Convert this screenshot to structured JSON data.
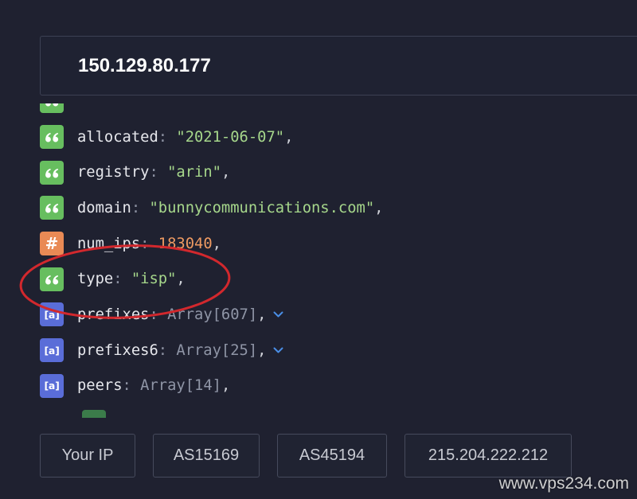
{
  "search": {
    "query": "150.129.80.177"
  },
  "syntax": {
    "colon": ":",
    "comma": ","
  },
  "icons": {
    "string": {
      "name": "quote-icon",
      "color": "#67be5f"
    },
    "number": {
      "name": "hash-icon",
      "glyph": "#",
      "color": "#e98a55"
    },
    "array": {
      "name": "array-icon",
      "glyph": "[a]",
      "color": "#5a6dd8"
    }
  },
  "rows": [
    {
      "icon": "quote-icon"
    },
    {
      "icon": "quote-icon",
      "key": "allocated",
      "value": "\"2021-06-07\""
    },
    {
      "icon": "quote-icon",
      "key": "registry",
      "value": "\"arin\""
    },
    {
      "icon": "quote-icon",
      "key": "domain",
      "value": "\"bunnycommunications.com\""
    },
    {
      "icon": "hash-icon",
      "key": "num_ips",
      "value": "183040"
    },
    {
      "icon": "quote-icon",
      "key": "type",
      "value": "\"isp\"",
      "highlighted": true
    },
    {
      "icon": "array-icon",
      "key": "prefixes",
      "value": "Array[607]",
      "expandable": true
    },
    {
      "icon": "array-icon",
      "key": "prefixes6",
      "value": "Array[25]",
      "expandable": true
    },
    {
      "icon": "array-icon",
      "key": "peers",
      "value": "Array[14]"
    },
    {
      "icon": "quote-icon",
      "indent": 1
    }
  ],
  "quick_links": [
    {
      "label": "Your IP"
    },
    {
      "label": "AS15169"
    },
    {
      "label": "AS45194"
    },
    {
      "label": "215.204.222.212"
    }
  ],
  "watermark": "www.vps234.com",
  "colors": {
    "bg": "#1f2130",
    "panel": "#1f2232",
    "border": "#3c4053",
    "key": "#e6e7ec",
    "punct": "#8c91a1",
    "string": "#a6d78b",
    "number": "#ee9a62",
    "array": "#8f95a6",
    "comma": "#cfd1d8",
    "chevron": "#4a8ee6",
    "icon-string": "#67be5f",
    "icon-number": "#e98a55",
    "icon-array": "#5a6dd8",
    "icon-dim": "#3b7c4a",
    "btn-bg": "#202332",
    "btn-border": "#464a5c",
    "btn-text": "#c8cad2",
    "annotation": "#d2282d"
  }
}
